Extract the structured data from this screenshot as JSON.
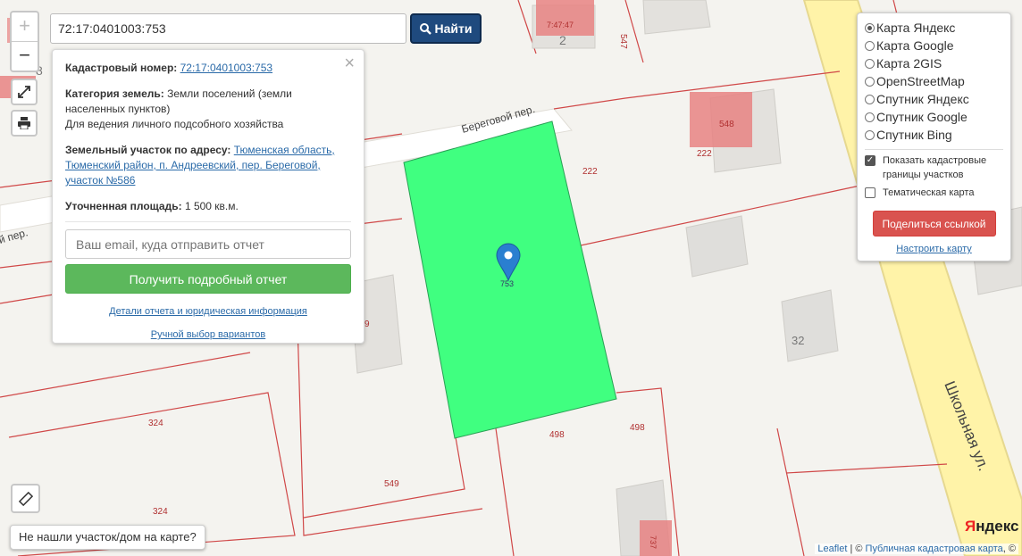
{
  "search": {
    "value": "72:17:0401003:753",
    "button_label": "Найти"
  },
  "zoom": {
    "in_label": "+",
    "out_label": "−"
  },
  "info": {
    "cadastral_label": "Кадастровый номер:",
    "cadastral_number": "72:17:0401003:753",
    "category_label": "Категория земель:",
    "category_value": "Земли поселений (земли населенных пунктов)",
    "usage": "Для ведения личного подсобного хозяйства",
    "address_label": "Земельный участок по адресу:",
    "address_value": "Тюменская область, Тюменский район, п. Андреевский, пер. Береговой, участок №586",
    "area_label": "Уточненная площадь:",
    "area_value": "1 500 кв.м.",
    "email_placeholder": "Ваш email, куда отправить отчет",
    "report_button": "Получить подробный отчет",
    "details_link": "Детали отчета и юридическая информация",
    "manual_link": "Ручной выбор вариантов"
  },
  "layers": {
    "options": [
      {
        "label": "Карта Яндекс",
        "selected": true
      },
      {
        "label": "Карта Google",
        "selected": false
      },
      {
        "label": "Карта 2GIS",
        "selected": false
      },
      {
        "label": "OpenStreetMap",
        "selected": false
      },
      {
        "label": "Спутник Яндекс",
        "selected": false
      },
      {
        "label": "Спутник Google",
        "selected": false
      },
      {
        "label": "Спутник Bing",
        "selected": false
      }
    ],
    "show_borders_label": "Показать кадастровые границы участков",
    "show_borders_checked": true,
    "thematic_label": "Тематическая карта",
    "thematic_checked": false,
    "share_button": "Поделиться ссылкой",
    "settings_link": "Настроить карту"
  },
  "not_found_button": "Не нашли участок/дом на карте?",
  "attribution": {
    "leaflet": "Leaflet",
    "sep": " | © ",
    "pkk": "Публичная кадастровая карта",
    "tail": ", ©"
  },
  "yandex_logo": {
    "y": "Я",
    "rest": "ндекс"
  },
  "map_labels": {
    "street_beregovoy": "Береговой пер.",
    "street_shkolnaya": "Школьная ул.",
    "street_left": "й пер.",
    "parcel_753": "753",
    "parcel_222a": "222",
    "parcel_222b": "222",
    "parcel_548": "548",
    "parcel_547": "547",
    "parcel_7": "7:47:47",
    "parcel_498a": "498",
    "parcel_498b": "498",
    "parcel_549": "549",
    "parcel_324a": "324",
    "parcel_324b": "324",
    "parcel_9": "9",
    "house_2": "2",
    "house_32": "32",
    "house_8": "8",
    "parcel_73": "737"
  },
  "colors": {
    "parcel_fill": "#40ff80",
    "boundary": "#d04848",
    "road": "#fff3a8",
    "search_button": "#1f4a7e",
    "report_button": "#5cb85c",
    "share_button": "#d9534f"
  }
}
